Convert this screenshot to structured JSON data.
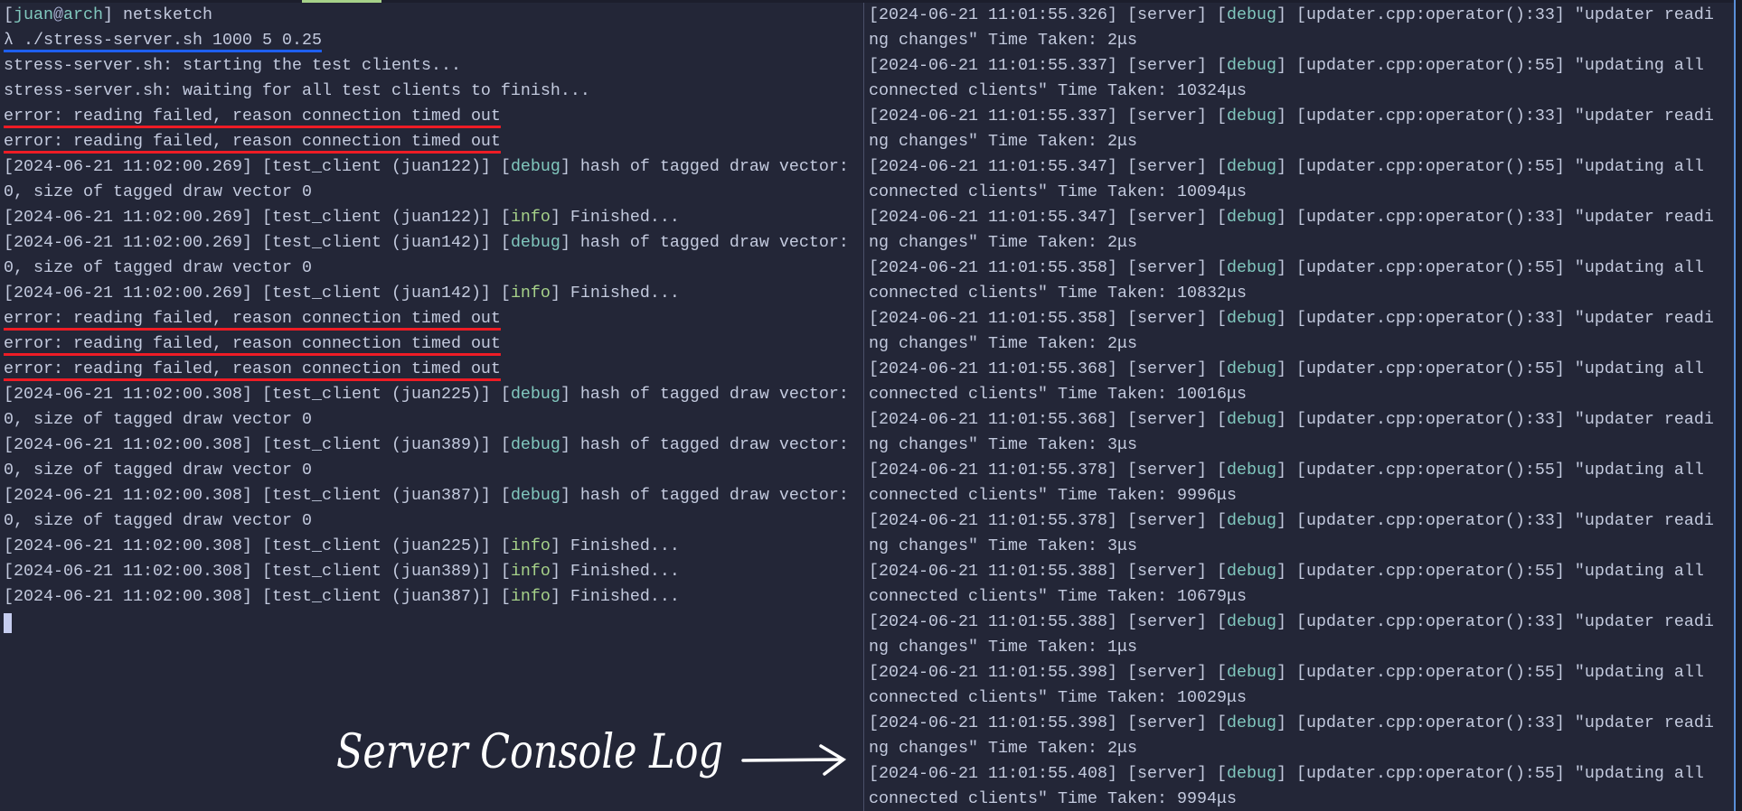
{
  "colors": {
    "background": "#232637",
    "text": "#c3cade",
    "debug": "#81c8be",
    "info": "#a6d189",
    "command_underline": "#1e5ff0",
    "error_underline": "#ee1c25",
    "active_tab": "#a6d189"
  },
  "left_terminal": {
    "lines": [
      [
        {
          "t": "["
        },
        {
          "t": "juan",
          "c": "user"
        },
        {
          "t": "@",
          "c": "at"
        },
        {
          "t": "arch",
          "c": "user"
        },
        {
          "t": "] netsketch"
        }
      ],
      [
        {
          "t": "λ ./stress-server.sh 1000 5 0.25",
          "c": "cmd"
        }
      ],
      [
        {
          "t": "stress-server.sh: starting the test clients..."
        }
      ],
      [
        {
          "t": "stress-server.sh: waiting for all test clients to finish..."
        }
      ],
      [
        {
          "t": "error: reading failed, reason connection timed out",
          "c": "err"
        }
      ],
      [
        {
          "t": "error: reading failed, reason connection timed out",
          "c": "err"
        }
      ],
      [
        {
          "t": "[2024-06-21 11:02:00.269] [test_client (juan122)] ["
        },
        {
          "t": "debug",
          "c": "debug"
        },
        {
          "t": "] hash of tagged draw vector: 0, size of tagged draw vector 0"
        }
      ],
      [
        {
          "t": "[2024-06-21 11:02:00.269] [test_client (juan122)] ["
        },
        {
          "t": "info",
          "c": "info"
        },
        {
          "t": "] Finished..."
        }
      ],
      [
        {
          "t": "[2024-06-21 11:02:00.269] [test_client (juan142)] ["
        },
        {
          "t": "debug",
          "c": "debug"
        },
        {
          "t": "] hash of tagged draw vector: 0, size of tagged draw vector 0"
        }
      ],
      [
        {
          "t": "[2024-06-21 11:02:00.269] [test_client (juan142)] ["
        },
        {
          "t": "info",
          "c": "info"
        },
        {
          "t": "] Finished..."
        }
      ],
      [
        {
          "t": "error: reading failed, reason connection timed out",
          "c": "err"
        }
      ],
      [
        {
          "t": "error: reading failed, reason connection timed out",
          "c": "err"
        }
      ],
      [
        {
          "t": "error: reading failed, reason connection timed out",
          "c": "err"
        }
      ],
      [
        {
          "t": "[2024-06-21 11:02:00.308] [test_client (juan225)] ["
        },
        {
          "t": "debug",
          "c": "debug"
        },
        {
          "t": "] hash of tagged draw vector: 0, size of tagged draw vector 0"
        }
      ],
      [
        {
          "t": "[2024-06-21 11:02:00.308] [test_client (juan389)] ["
        },
        {
          "t": "debug",
          "c": "debug"
        },
        {
          "t": "] hash of tagged draw vector: 0, size of tagged draw vector 0"
        }
      ],
      [
        {
          "t": "[2024-06-21 11:02:00.308] [test_client (juan387)] ["
        },
        {
          "t": "debug",
          "c": "debug"
        },
        {
          "t": "] hash of tagged draw vector: 0, size of tagged draw vector 0"
        }
      ],
      [
        {
          "t": "[2024-06-21 11:02:00.308] [test_client (juan225)] ["
        },
        {
          "t": "info",
          "c": "info"
        },
        {
          "t": "] Finished..."
        }
      ],
      [
        {
          "t": "[2024-06-21 11:02:00.308] [test_client (juan389)] ["
        },
        {
          "t": "info",
          "c": "info"
        },
        {
          "t": "] Finished..."
        }
      ],
      [
        {
          "t": "[2024-06-21 11:02:00.308] [test_client (juan387)] ["
        },
        {
          "t": "info",
          "c": "info"
        },
        {
          "t": "] Finished..."
        }
      ]
    ]
  },
  "right_terminal": {
    "lines": [
      [
        {
          "t": "[2024-06-21 11:01:55.326] [server] ["
        },
        {
          "t": "debug",
          "c": "debug"
        },
        {
          "t": "] [updater.cpp:operator():33] \"updater reading changes\" Time Taken: 2μs"
        }
      ],
      [
        {
          "t": "[2024-06-21 11:01:55.337] [server] ["
        },
        {
          "t": "debug",
          "c": "debug"
        },
        {
          "t": "] [updater.cpp:operator():55] \"updating all connected clients\" Time Taken: 10324μs"
        }
      ],
      [
        {
          "t": "[2024-06-21 11:01:55.337] [server] ["
        },
        {
          "t": "debug",
          "c": "debug"
        },
        {
          "t": "] [updater.cpp:operator():33] \"updater reading changes\" Time Taken: 2μs"
        }
      ],
      [
        {
          "t": "[2024-06-21 11:01:55.347] [server] ["
        },
        {
          "t": "debug",
          "c": "debug"
        },
        {
          "t": "] [updater.cpp:operator():55] \"updating all connected clients\" Time Taken: 10094μs"
        }
      ],
      [
        {
          "t": "[2024-06-21 11:01:55.347] [server] ["
        },
        {
          "t": "debug",
          "c": "debug"
        },
        {
          "t": "] [updater.cpp:operator():33] \"updater reading changes\" Time Taken: 2μs"
        }
      ],
      [
        {
          "t": "[2024-06-21 11:01:55.358] [server] ["
        },
        {
          "t": "debug",
          "c": "debug"
        },
        {
          "t": "] [updater.cpp:operator():55] \"updating all connected clients\" Time Taken: 10832μs"
        }
      ],
      [
        {
          "t": "[2024-06-21 11:01:55.358] [server] ["
        },
        {
          "t": "debug",
          "c": "debug"
        },
        {
          "t": "] [updater.cpp:operator():33] \"updater reading changes\" Time Taken: 2μs"
        }
      ],
      [
        {
          "t": "[2024-06-21 11:01:55.368] [server] ["
        },
        {
          "t": "debug",
          "c": "debug"
        },
        {
          "t": "] [updater.cpp:operator():55] \"updating all connected clients\" Time Taken: 10016μs"
        }
      ],
      [
        {
          "t": "[2024-06-21 11:01:55.368] [server] ["
        },
        {
          "t": "debug",
          "c": "debug"
        },
        {
          "t": "] [updater.cpp:operator():33] \"updater reading changes\" Time Taken: 3μs"
        }
      ],
      [
        {
          "t": "[2024-06-21 11:01:55.378] [server] ["
        },
        {
          "t": "debug",
          "c": "debug"
        },
        {
          "t": "] [updater.cpp:operator():55] \"updating all connected clients\" Time Taken: 9996μs"
        }
      ],
      [
        {
          "t": "[2024-06-21 11:01:55.378] [server] ["
        },
        {
          "t": "debug",
          "c": "debug"
        },
        {
          "t": "] [updater.cpp:operator():33] \"updater reading changes\" Time Taken: 3μs"
        }
      ],
      [
        {
          "t": "[2024-06-21 11:01:55.388] [server] ["
        },
        {
          "t": "debug",
          "c": "debug"
        },
        {
          "t": "] [updater.cpp:operator():55] \"updating all connected clients\" Time Taken: 10679μs"
        }
      ],
      [
        {
          "t": "[2024-06-21 11:01:55.388] [server] ["
        },
        {
          "t": "debug",
          "c": "debug"
        },
        {
          "t": "] [updater.cpp:operator():33] \"updater reading changes\" Time Taken: 1μs"
        }
      ],
      [
        {
          "t": "[2024-06-21 11:01:55.398] [server] ["
        },
        {
          "t": "debug",
          "c": "debug"
        },
        {
          "t": "] [updater.cpp:operator():55] \"updating all connected clients\" Time Taken: 10029μs"
        }
      ],
      [
        {
          "t": "[2024-06-21 11:01:55.398] [server] ["
        },
        {
          "t": "debug",
          "c": "debug"
        },
        {
          "t": "] [updater.cpp:operator():33] \"updater reading changes\" Time Taken: 2μs"
        }
      ],
      [
        {
          "t": "[2024-06-21 11:01:55.408] [server] ["
        },
        {
          "t": "debug",
          "c": "debug"
        },
        {
          "t": "] [updater.cpp:operator():55] \"updating all connected clients\" Time Taken: 9994μs"
        }
      ]
    ]
  },
  "annotation": {
    "text": "Server Console Log",
    "icon": "arrow-right-icon"
  }
}
